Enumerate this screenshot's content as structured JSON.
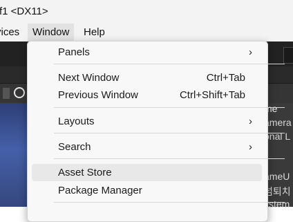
{
  "window": {
    "title": "f1 <DX11>"
  },
  "menubar": {
    "items": [
      "vices",
      "Window",
      "Help"
    ]
  },
  "window_menu": {
    "items": [
      {
        "label": "Panels",
        "submenu": true
      },
      {
        "label": "Next Window",
        "shortcut": "Ctrl+Tab"
      },
      {
        "label": "Previous Window",
        "shortcut": "Ctrl+Shift+Tab"
      },
      {
        "label": "Layouts",
        "submenu": true
      },
      {
        "label": "Search",
        "submenu": true
      },
      {
        "label": "Asset Store",
        "highlighted": true
      },
      {
        "label": "Package Manager"
      }
    ]
  },
  "right_panel": {
    "rows": [
      "me",
      "amera",
      "onal L",
      "ameU",
      "넘퇴치",
      "ystem"
    ]
  },
  "colors": {
    "menu_bg": "#f8f8f8",
    "highlight": "#e8e8e8",
    "editor_dark": "#222222"
  }
}
